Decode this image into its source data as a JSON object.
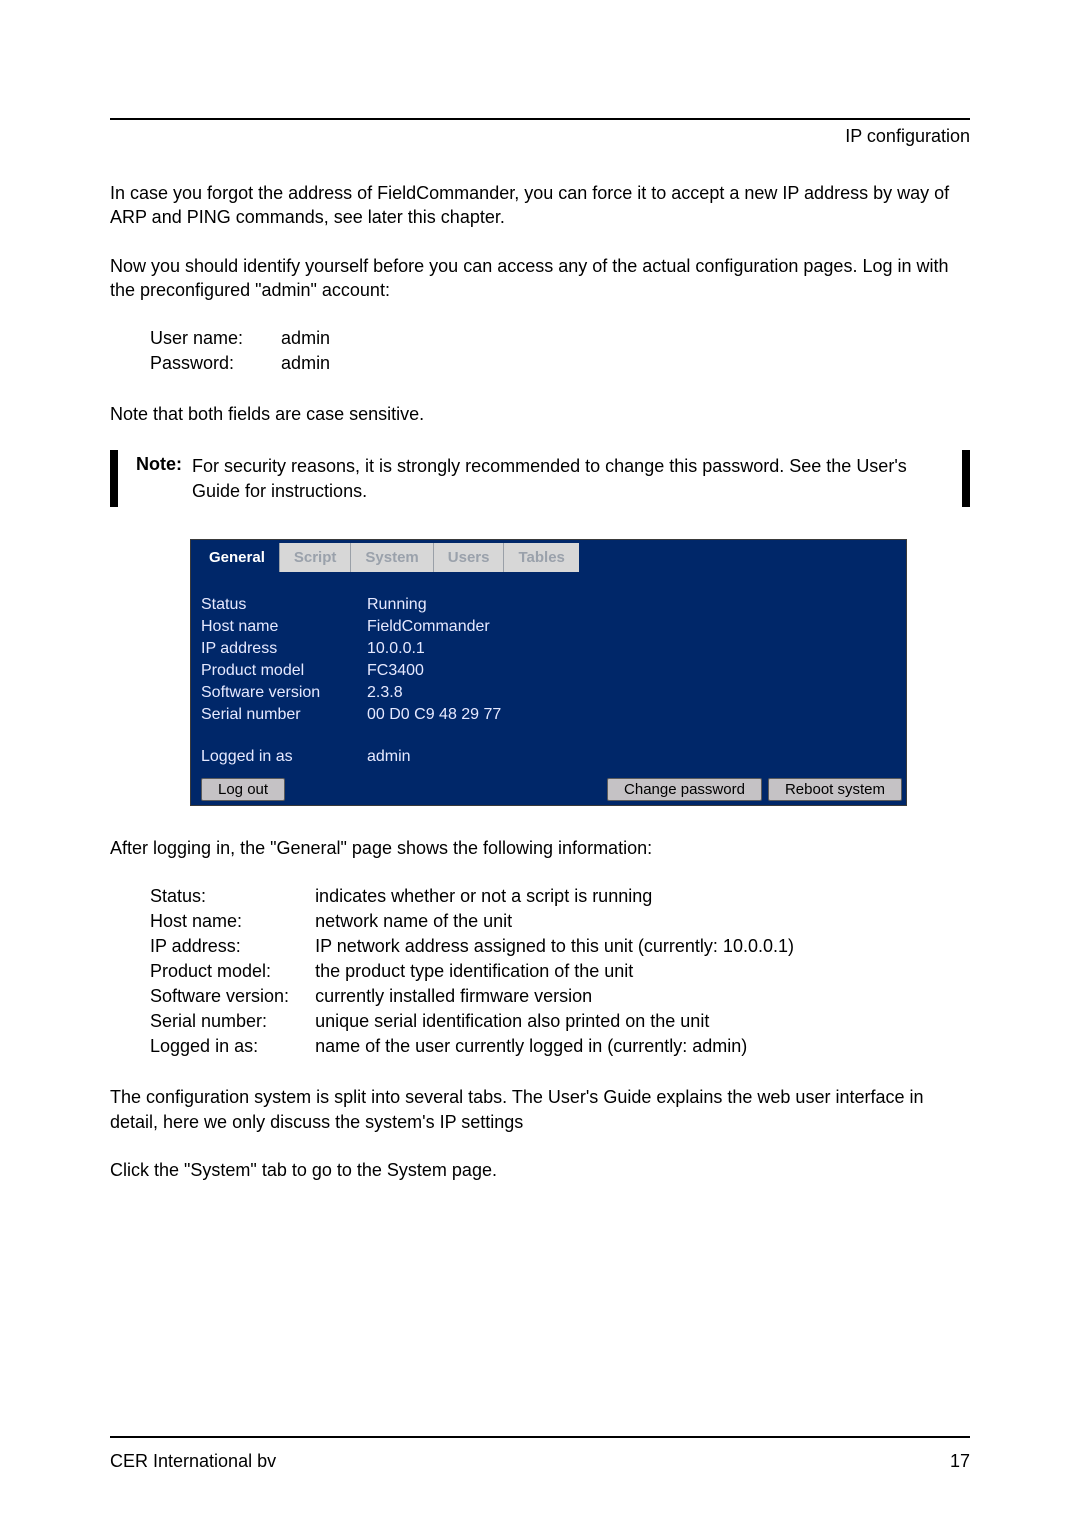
{
  "header": {
    "title": "IP configuration"
  },
  "body": {
    "p1": "In case you forgot the address of FieldCommander, you can force it to accept a new IP address by way of ARP and PING commands, see later this chapter.",
    "p2": "Now you should identify yourself before you can access any of the actual configuration pages. Log in with the preconfigured \"admin\" account:",
    "credentials": {
      "user_label": "User name:",
      "user_value": "admin",
      "pass_label": "Password:",
      "pass_value": "admin"
    },
    "p3": "Note that both fields are case sensitive.",
    "note": {
      "label": "Note:",
      "text": "For security reasons, it is strongly recommended to change this password. See the User's Guide for instructions."
    },
    "p4": "After logging in, the \"General\" page shows the following information:",
    "info": [
      {
        "k": "Status:",
        "v": "indicates whether or not a script is running"
      },
      {
        "k": "Host name:",
        "v": "network name of the unit"
      },
      {
        "k": "IP address:",
        "v": "IP network address assigned to this unit (currently: 10.0.0.1)"
      },
      {
        "k": "Product model:",
        "v": "the product type identification of the unit"
      },
      {
        "k": "Software version:",
        "v": "currently installed firmware version"
      },
      {
        "k": "Serial number:",
        "v": "unique serial identification also printed on the unit"
      },
      {
        "k": "Logged in as:",
        "v": "name of the user currently logged in (currently: admin)"
      }
    ],
    "p5": "The configuration system is split into several tabs. The User's Guide explains the web user interface in detail, here we only discuss the system's IP settings",
    "p6": "Click the \"System\" tab to go to the System page."
  },
  "screenshot": {
    "tabs": [
      {
        "label": "General",
        "active": true
      },
      {
        "label": "Script",
        "active": false
      },
      {
        "label": "System",
        "active": false
      },
      {
        "label": "Users",
        "active": false
      },
      {
        "label": "Tables",
        "active": false
      }
    ],
    "rows": [
      {
        "k": "Status",
        "v": "Running"
      },
      {
        "k": "Host name",
        "v": "FieldCommander"
      },
      {
        "k": "IP address",
        "v": "10.0.0.1"
      },
      {
        "k": "Product model",
        "v": "FC3400"
      },
      {
        "k": "Software version",
        "v": "2.3.8"
      },
      {
        "k": "Serial number",
        "v": "00 D0 C9 48 29 77"
      }
    ],
    "logged_in": {
      "k": "Logged in as",
      "v": "admin"
    },
    "buttons": {
      "logout": "Log out",
      "change_password": "Change password",
      "reboot": "Reboot system"
    }
  },
  "footer": {
    "left": "CER International bv",
    "right": "17"
  }
}
